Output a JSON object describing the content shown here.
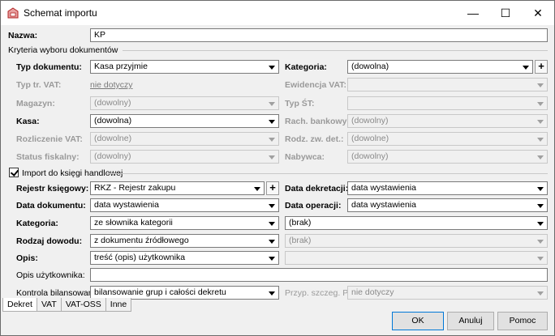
{
  "window": {
    "title": "Schemat importu",
    "minimize": "—",
    "maximize": "☐",
    "close": "✕"
  },
  "nazwa": {
    "label": "Nazwa:",
    "value": "KP"
  },
  "kryteria": {
    "group_label": "Kryteria wyboru dokumentów",
    "typ_dokumentu": {
      "label": "Typ dokumentu:",
      "value": "Kasa przyjmie"
    },
    "kategoria": {
      "label": "Kategoria:",
      "value": "(dowolna)"
    },
    "typ_tr_vat": {
      "label": "Typ tr. VAT:",
      "value": "nie dotyczy"
    },
    "ewidencja_vat": {
      "label": "Ewidencja VAT:",
      "value": ""
    },
    "magazyn": {
      "label": "Magazyn:",
      "value": "(dowolny)"
    },
    "typ_st": {
      "label": "Typ ŚT:",
      "value": ""
    },
    "kasa": {
      "label": "Kasa:",
      "value": "(dowolna)"
    },
    "rach_bankowy": {
      "label": "Rach. bankowy:",
      "value": "(dowolny)"
    },
    "rozliczenie_vat": {
      "label": "Rozliczenie VAT:",
      "value": "(dowolne)"
    },
    "rodz_zw_det": {
      "label": "Rodz. zw. det.:",
      "value": "(dowolne)"
    },
    "status_fiskalny": {
      "label": "Status fiskalny:",
      "value": "(dowolny)"
    },
    "nabywca": {
      "label": "Nabywca:",
      "value": "(dowolny)"
    }
  },
  "import": {
    "checkbox_label": "Import do księgi handlowej",
    "checked": true,
    "rejestr_ksiegowy": {
      "label": "Rejestr księgowy:",
      "value": "RKZ - Rejestr zakupu"
    },
    "data_dekretacji": {
      "label": "Data dekretacji:",
      "value": "data wystawienia"
    },
    "data_dokumentu": {
      "label": "Data dokumentu:",
      "value": "data wystawienia"
    },
    "data_operacji": {
      "label": "Data operacji:",
      "value": "data wystawienia"
    },
    "kategoria": {
      "label": "Kategoria:",
      "value": "ze słownika kategorii",
      "value2": "(brak)"
    },
    "rodzaj_dowodu": {
      "label": "Rodzaj dowodu:",
      "value": "z dokumentu źródłowego",
      "value2": "(brak)"
    },
    "opis": {
      "label": "Opis:",
      "value": "treść (opis) użytkownika",
      "value2": ""
    },
    "opis_uzytkownika": {
      "label": "Opis użytkownika:",
      "value": ""
    },
    "kontrola_bilansowania": {
      "label": "Kontrola bilansowania:",
      "value": "bilansowanie grup i całości dekretu"
    },
    "przyp_szczeg_pit": {
      "label": "Przyp. szczeg. PIT:",
      "value": "nie dotyczy"
    }
  },
  "tabs": [
    "Dekret",
    "VAT",
    "VAT-OSS",
    "Inne"
  ],
  "buttons": {
    "ok": "OK",
    "anuluj": "Anuluj",
    "pomoc": "Pomoc"
  }
}
